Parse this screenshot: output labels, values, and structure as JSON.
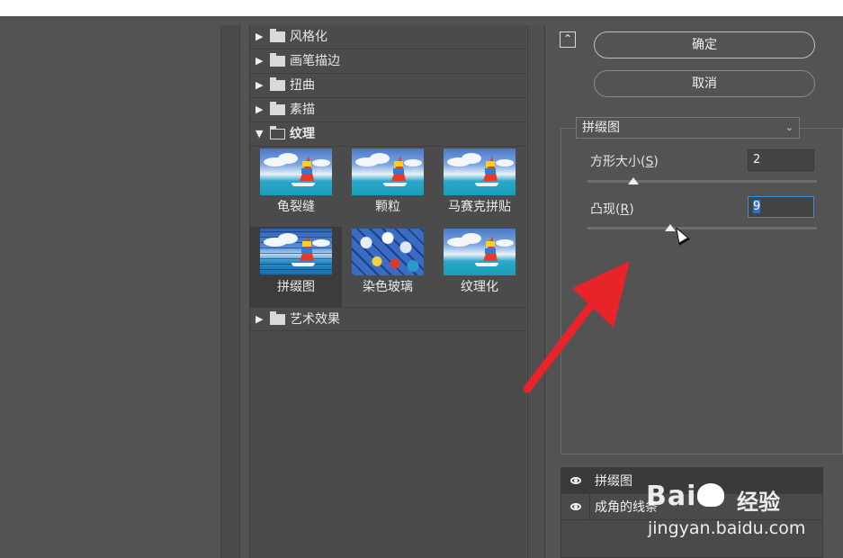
{
  "gallery": {
    "categories_top": [
      {
        "label": "风格化",
        "expanded": false
      },
      {
        "label": "画笔描边",
        "expanded": false
      },
      {
        "label": "扭曲",
        "expanded": false
      },
      {
        "label": "素描",
        "expanded": false
      },
      {
        "label": "纹理",
        "expanded": true
      }
    ],
    "filters": [
      {
        "label": "龟裂缝",
        "selected": false
      },
      {
        "label": "颗粒",
        "selected": false
      },
      {
        "label": "马赛克拼贴",
        "selected": false
      },
      {
        "label": "拼缀图",
        "selected": true
      },
      {
        "label": "染色玻璃",
        "selected": false
      },
      {
        "label": "纹理化",
        "selected": false
      }
    ],
    "categories_bottom": [
      {
        "label": "艺术效果",
        "expanded": false
      }
    ]
  },
  "settings": {
    "collapse_icon": "chevron-up-double-icon",
    "ok_label": "确定",
    "cancel_label": "取消",
    "filter_select": "拼缀图",
    "square_size_label": "方形大小",
    "square_size_hotkey": "S",
    "square_size_value": "2",
    "square_size_slider": 0.2,
    "relief_label": "凸现",
    "relief_hotkey": "R",
    "relief_value": "9",
    "relief_slider": 0.36
  },
  "layers": [
    {
      "name": "拼缀图",
      "visible": true,
      "selected": true
    },
    {
      "name": "成角的线条",
      "visible": true,
      "selected": false
    }
  ],
  "watermark": {
    "brand_left": "Bai",
    "brand_right": "经验",
    "url": "jingyan.baidu.com"
  },
  "annotation": {
    "arrow_color": "#e8232a"
  }
}
